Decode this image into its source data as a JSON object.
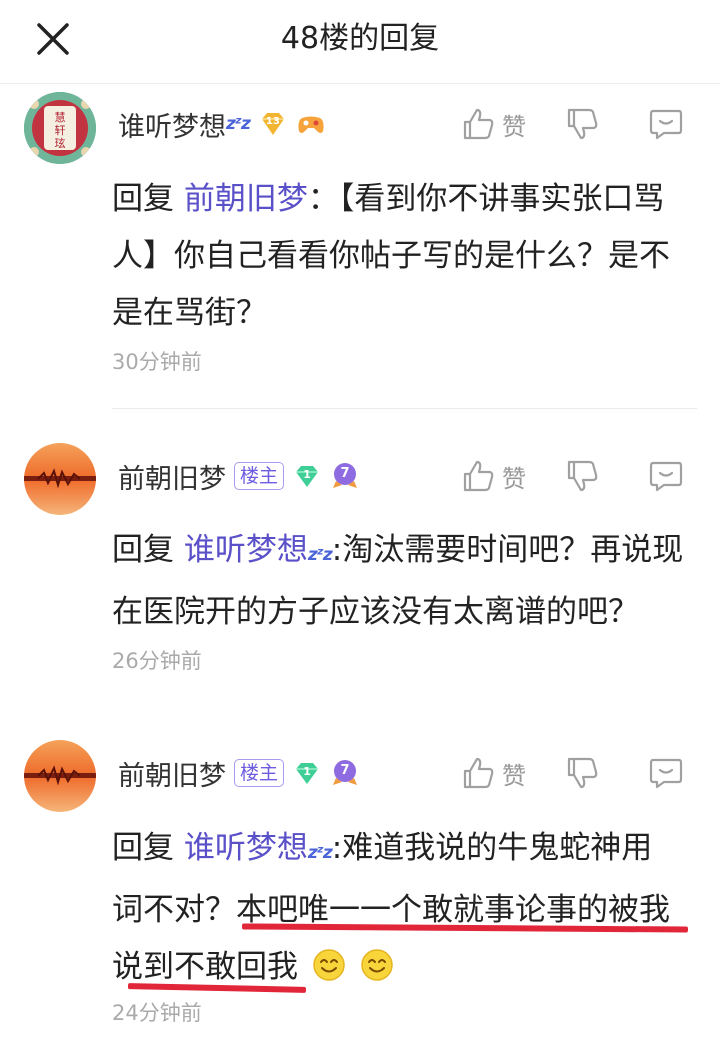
{
  "header": {
    "title": "48楼的回复"
  },
  "actions": {
    "like_label": "赞"
  },
  "comments": [
    {
      "username": "谁听梦想",
      "zz": "zᶻz",
      "gem_level": "13",
      "avatar_text": "慧轩玹",
      "reply_prefix": "回复",
      "reply_to": "前朝旧梦",
      "text": "：【看到你不讲事实张口骂人】你自己看看你帖子写的是什么？是不是在骂街？",
      "time": "30分钟前"
    },
    {
      "username": "前朝旧梦",
      "owner_badge": "楼主",
      "gem_level": "1",
      "user_level": "7",
      "reply_prefix": "回复",
      "reply_to": "谁听梦想",
      "reply_to_zz": "zᶻz",
      "text": ":淘汰需要时间吧？再说现在医院开的方子应该没有太离谱的吧？",
      "time": "26分钟前"
    },
    {
      "username": "前朝旧梦",
      "owner_badge": "楼主",
      "gem_level": "1",
      "user_level": "7",
      "reply_prefix": "回复",
      "reply_to": "谁听梦想",
      "reply_to_zz": "zᶻz",
      "text_line1": ":难道我说的牛鬼蛇神用",
      "text_line2": "词不对？本吧唯一一个敢就事论事的被我",
      "text_line3": "说到不敢回我",
      "time": "24分钟前"
    }
  ]
}
